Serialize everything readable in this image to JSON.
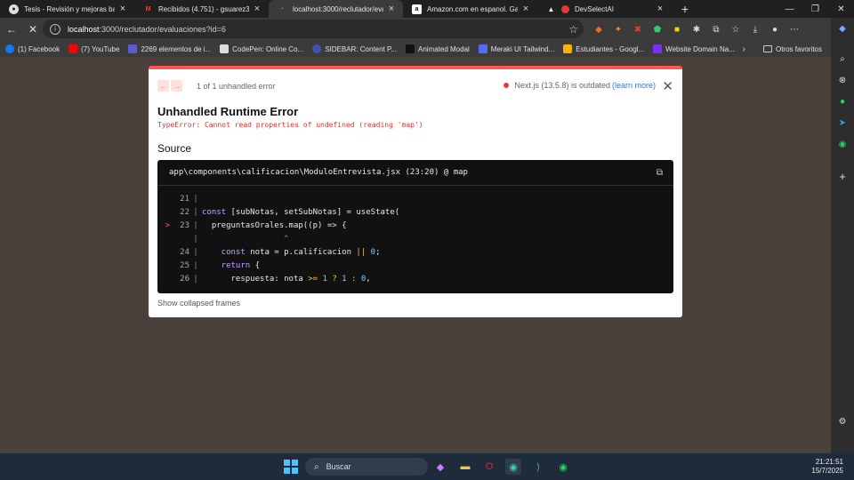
{
  "browser": {
    "tabs": [
      {
        "title": "Tesis - Revisión y mejoras backend",
        "icon": "github-icon",
        "active": false
      },
      {
        "title": "Recibidos (4.751) - gsuarez3@ur",
        "icon": "gmail-icon",
        "active": false
      },
      {
        "title": "localhost:3000/reclutador/evalua",
        "icon": "loading-icon",
        "active": true
      },
      {
        "title": "Amazon.com en espanol. Gasta m",
        "icon": "amazon-icon",
        "active": false
      },
      {
        "title": "DevSelectAI",
        "icon": "devselect-icon",
        "active": false
      }
    ],
    "address": {
      "host": "localhost",
      "path": ":3000/reclutador/evaluaciones?id=6"
    },
    "bookmarks": [
      {
        "label": "(1) Facebook",
        "color": "#1877f2"
      },
      {
        "label": "(7) YouTube",
        "color": "#ff0000"
      },
      {
        "label": "2269 elementos de i...",
        "color": "#5b5bd6"
      },
      {
        "label": "CodePen: Online Co...",
        "color": "#dddddd"
      },
      {
        "label": "SIDEBAR: Content P...",
        "color": "#3f51b5"
      },
      {
        "label": "Animated Modal",
        "color": "#111111"
      },
      {
        "label": "Meraki UI Tailwind...",
        "color": "#4f6cf7"
      },
      {
        "label": "Estudiantes - Googl...",
        "color": "#f4b400"
      },
      {
        "label": "Website Domain Na...",
        "color": "#7b2ff7"
      }
    ],
    "other_bookmarks": "Otros favoritos"
  },
  "error_overlay": {
    "pager_text": "1 of 1 unhandled error",
    "nextjs_status": "Next.js (13.5.8) is outdated",
    "learn_more": "(learn more)",
    "title": "Unhandled Runtime Error",
    "message": "TypeError: Cannot read properties of undefined (reading 'map')",
    "source_heading": "Source",
    "file_ref": "app\\components\\calificacion\\ModuloEntrevista.jsx (23:20) @ map",
    "show_collapsed": "Show collapsed frames",
    "accent": "#ff5555"
  },
  "code_lines": {
    "l21": "21",
    "l22": "22",
    "l23": "23",
    "l24": "24",
    "l25": "25",
    "l26": "26",
    "t22a": "const",
    "t22b": " [subNotas, setSubNotas] = useState(",
    "t23": "  preguntasOrales.map((p) => {",
    "caret": "^",
    "t24a": "    const",
    "t24b": " nota = p.calificacion ",
    "t24c": "||",
    "t24d": " 0",
    "t24e": ";",
    "t25a": "    return",
    "t25b": " {",
    "t26a": "      respuesta: nota ",
    "t26b": ">=",
    "t26c": " 1",
    "t26d": " ?",
    "t26e": " 1",
    "t26f": " :",
    "t26g": " 0",
    "t26h": ","
  },
  "taskbar": {
    "search": "Buscar",
    "time": "21:21:51",
    "date": "15/7/2025"
  }
}
